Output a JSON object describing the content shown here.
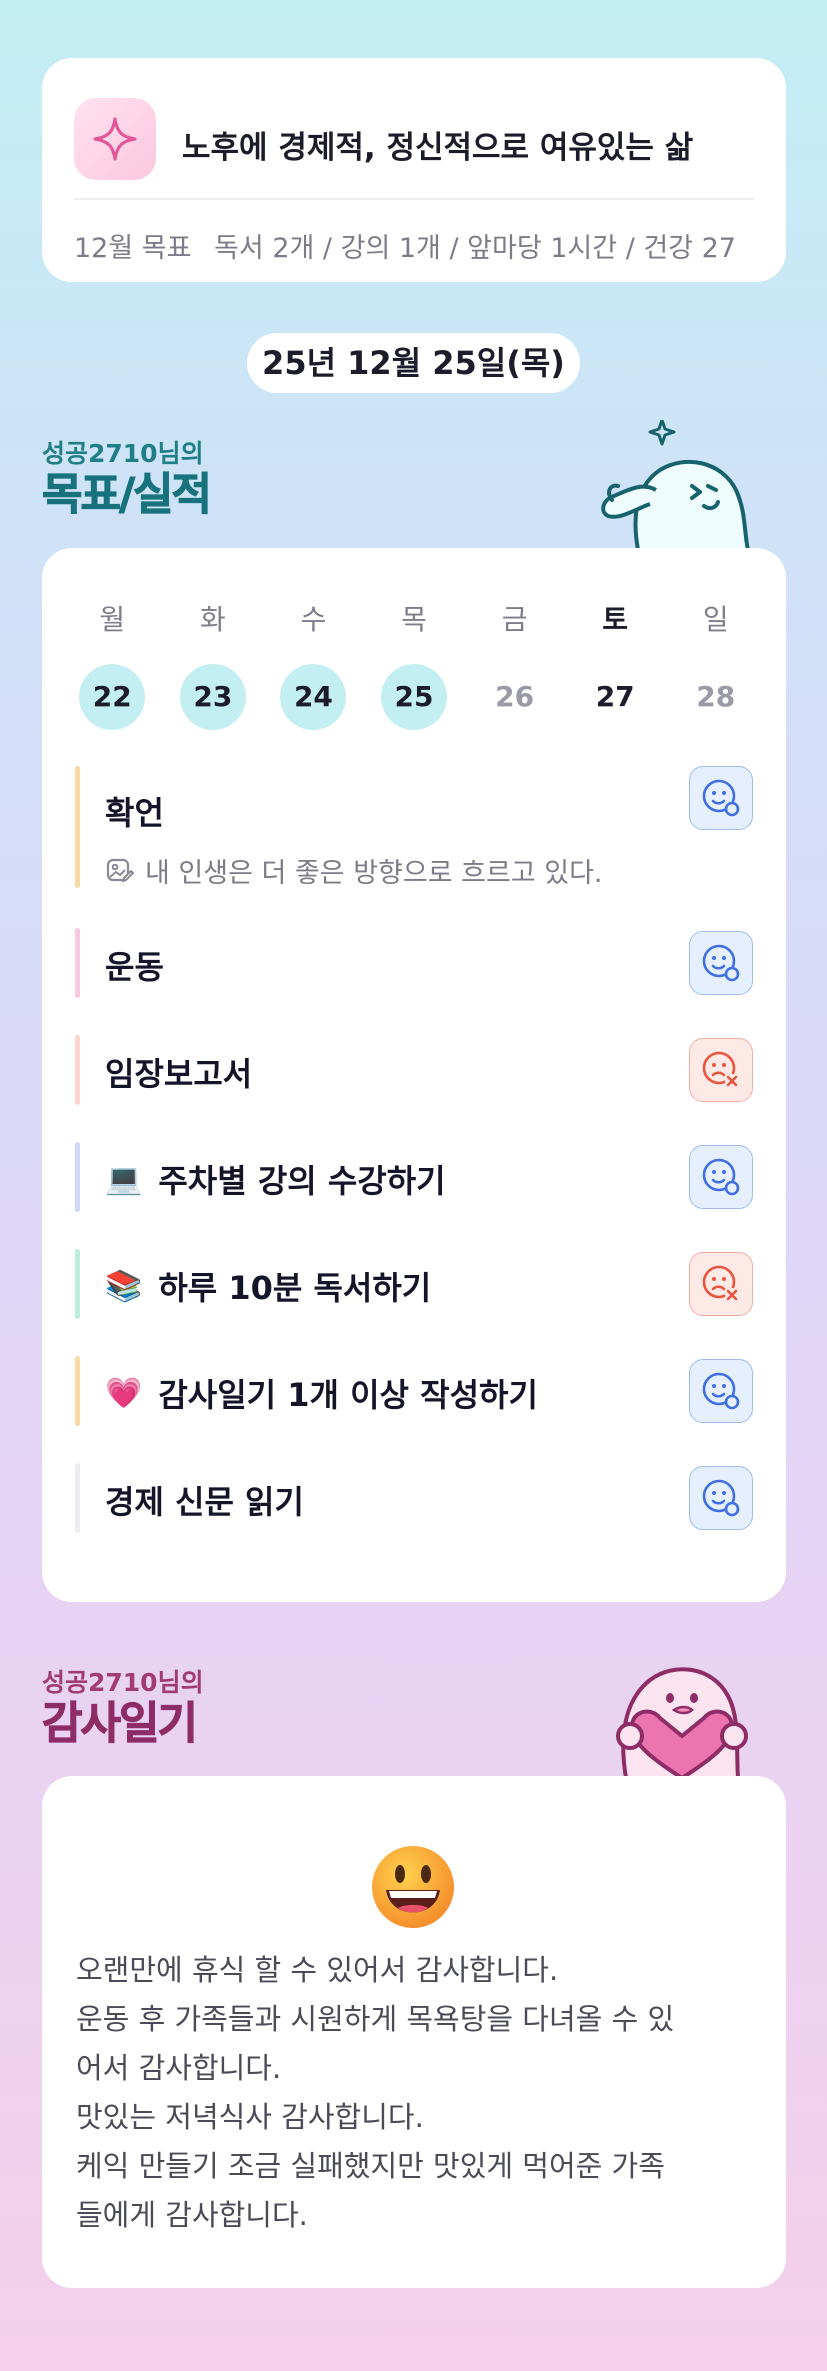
{
  "goal": {
    "title": "노후에 경제적, 정신적으로 여유있는 삶",
    "month_label": "12월 목표",
    "month_goals": "독서 2개 / 강의 1개 / 앞마당 1시간 / 건강 27"
  },
  "date": "25년 12월 25일(목)",
  "tracker_section": {
    "subtitle": "성공2710님의",
    "title": "목표/실적"
  },
  "week": [
    {
      "name": "월",
      "num": "22",
      "done": true
    },
    {
      "name": "화",
      "num": "23",
      "done": true
    },
    {
      "name": "수",
      "num": "24",
      "done": true
    },
    {
      "name": "목",
      "num": "25",
      "done": true
    },
    {
      "name": "금",
      "num": "26",
      "done": false
    },
    {
      "name": "토",
      "num": "27",
      "done": false
    },
    {
      "name": "일",
      "num": "28",
      "done": false
    }
  ],
  "habits": [
    {
      "title": "확언",
      "emoji": "",
      "note": "내 인생은 더 좋은 방향으로 흐르고 있다.",
      "status": "success",
      "bar_color": "#f8d9a3"
    },
    {
      "title": "운동",
      "emoji": "",
      "status": "success",
      "bar_color": "#f8c9e0"
    },
    {
      "title": "임장보고서",
      "emoji": "",
      "status": "fail",
      "bar_color": "#fbd4cf"
    },
    {
      "title": "주차별 강의 수강하기",
      "emoji": "💻",
      "status": "success",
      "bar_color": "#cfd9f7"
    },
    {
      "title": "하루 10분 독서하기",
      "emoji": "📚",
      "status": "fail",
      "bar_color": "#bdeedd"
    },
    {
      "title": "감사일기 1개 이상 작성하기",
      "emoji": "💗",
      "status": "success",
      "bar_color": "#f8d9a3"
    },
    {
      "title": "경제 신문 읽기",
      "emoji": "",
      "status": "success",
      "bar_color": "#ececf1"
    }
  ],
  "gratitude_section": {
    "subtitle": "성공2710님의",
    "title": "감사일기"
  },
  "gratitude": {
    "emoji": "grinning-face",
    "lines": [
      "오랜만에 휴식 할 수 있어서 감사합니다.",
      "운동 후 가족들과 시원하게 목욕탕을 다녀올 수 있",
      "어서 감사합니다.",
      "맛있는 저녁식사 감사합니다.",
      "케익 만들기 조금 실패했지만 맛있게 먹어준 가족",
      "들에게 감사합니다."
    ]
  },
  "colors": {
    "success": "#3f6fe3",
    "fail": "#e8553d",
    "done_day": "#c3eff2",
    "teal_heading": "#17727c",
    "plum_heading": "#8d2c66"
  }
}
